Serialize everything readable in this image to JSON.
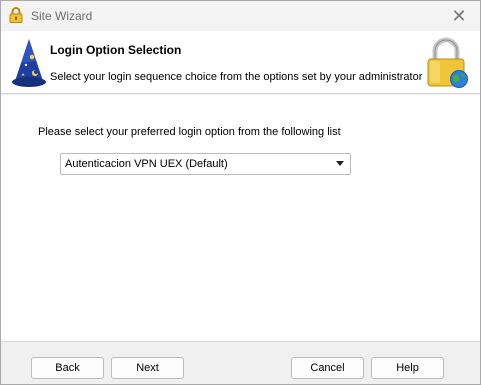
{
  "window": {
    "title": "Site Wizard",
    "close_glyph": "✕",
    "title_icon": "lock-icon"
  },
  "header": {
    "title": "Login Option Selection",
    "subtitle": "Select your login sequence choice from the options set by your administrator",
    "left_icon": "wizard-hat-icon",
    "right_icon": "padlock-globe-icon"
  },
  "main": {
    "prompt": "Please select your preferred  login option from the following list",
    "login_option": {
      "selected": "Autenticacion VPN UEX  (Default)"
    }
  },
  "buttons": {
    "back": "Back",
    "next": "Next",
    "cancel": "Cancel",
    "help": "Help"
  }
}
